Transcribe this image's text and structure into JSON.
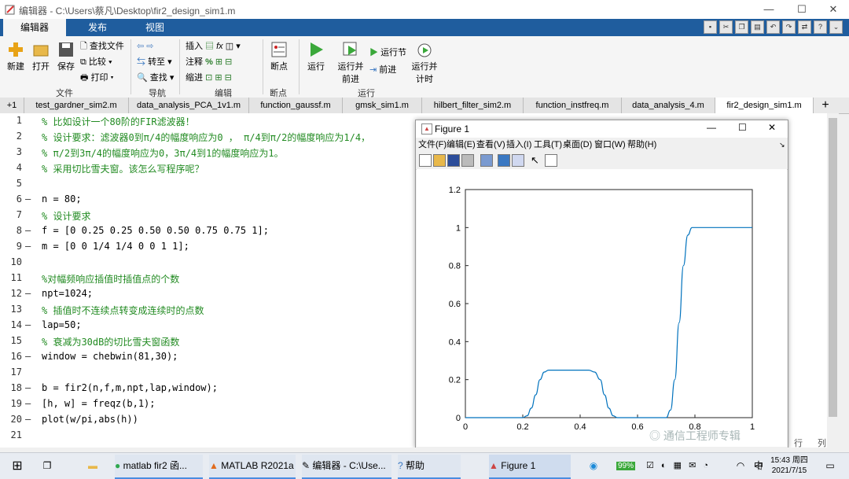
{
  "window": {
    "title": "编辑器 - C:\\Users\\蔡凡\\Desktop\\fir2_design_sim1.m"
  },
  "ribbon_tabs": [
    "编辑器",
    "发布",
    "视图"
  ],
  "ribbon": {
    "file": {
      "new": "新建",
      "open": "打开",
      "save": "保存",
      "find_files": "查找文件",
      "compare": "比较",
      "print": "打印",
      "group": "文件"
    },
    "nav": {
      "goto": "转至",
      "find": "查找",
      "group": "导航"
    },
    "edit": {
      "insert": "插入",
      "comment": "注释",
      "indent": "缩进",
      "fx": "fx",
      "group": "编辑"
    },
    "breakpoints": {
      "label": "断点",
      "group": "断点"
    },
    "run": {
      "run": "运行",
      "run_advance_1": "运行并",
      "run_advance_2": "前进",
      "run_section": "运行节",
      "advance": "前进",
      "run_time_1": "运行并",
      "run_time_2": "计时",
      "group": "运行"
    }
  },
  "file_tabs": {
    "plus": "+1",
    "items": [
      "test_gardner_sim2.m",
      "data_analysis_PCA_1v1.m",
      "function_gaussf.m",
      "gmsk_sim1.m",
      "hilbert_filter_sim2.m",
      "function_instfreq.m",
      "data_analysis_4.m",
      "fir2_design_sim1.m"
    ],
    "active": "fir2_design_sim1.m"
  },
  "code_lines": [
    {
      "n": "1",
      "dash": "",
      "text": "% 比如设计一个80阶的FIR滤波器！",
      "type": "comment"
    },
    {
      "n": "2",
      "dash": "",
      "text": "% 设计要求：滤波器0到π/4的幅度响应为0 ， π/4到π/2的幅度响应为1/4，",
      "type": "comment"
    },
    {
      "n": "3",
      "dash": "",
      "text": "% π/2到3π/4的幅度响应为0，3π/4到1的幅度响应为1。",
      "type": "comment"
    },
    {
      "n": "4",
      "dash": "",
      "text": "% 采用切比雪夫窗。该怎么写程序呢？",
      "type": "comment"
    },
    {
      "n": "5",
      "dash": "",
      "text": "",
      "type": "code"
    },
    {
      "n": "6",
      "dash": "—",
      "text": "n = 80;",
      "type": "code"
    },
    {
      "n": "7",
      "dash": "",
      "text": "% 设计要求",
      "type": "comment"
    },
    {
      "n": "8",
      "dash": "—",
      "text": "f = [0 0.25 0.25 0.50 0.50 0.75 0.75 1];",
      "type": "code"
    },
    {
      "n": "9",
      "dash": "—",
      "text": "m = [0 0 1/4 1/4 0 0 1 1];",
      "type": "code"
    },
    {
      "n": "10",
      "dash": "",
      "text": "",
      "type": "code"
    },
    {
      "n": "11",
      "dash": "",
      "text": "%对幅频响应插值时插值点的个数",
      "type": "comment"
    },
    {
      "n": "12",
      "dash": "—",
      "text": "npt=1024;",
      "type": "code"
    },
    {
      "n": "13",
      "dash": "",
      "text": "% 插值时不连续点转变成连续时的点数",
      "type": "comment"
    },
    {
      "n": "14",
      "dash": "—",
      "text": "lap=50;",
      "type": "code"
    },
    {
      "n": "15",
      "dash": "",
      "text": "% 衰减为30dB的切比雪夫窗函数",
      "type": "comment"
    },
    {
      "n": "16",
      "dash": "—",
      "text": "window = chebwin(81,30);",
      "type": "code"
    },
    {
      "n": "17",
      "dash": "",
      "text": "",
      "type": "code"
    },
    {
      "n": "18",
      "dash": "—",
      "text": "b = fir2(n,f,m,npt,lap,window);",
      "type": "code"
    },
    {
      "n": "19",
      "dash": "—",
      "text": "[h, w] = freqz(b,1);",
      "type": "code"
    },
    {
      "n": "20",
      "dash": "—",
      "text": "plot(w/pi,abs(h))",
      "type": "code"
    },
    {
      "n": "21",
      "dash": "",
      "text": "",
      "type": "code"
    }
  ],
  "figure": {
    "title": "Figure 1",
    "menu": [
      "文件(F)",
      "编辑(E)",
      "查看(V)",
      "插入(I)",
      "工具(T)",
      "桌面(D)",
      "窗口(W)",
      "帮助(H)"
    ]
  },
  "chart_data": {
    "type": "line",
    "title": "",
    "xlabel": "",
    "ylabel": "",
    "xlim": [
      0,
      1
    ],
    "ylim": [
      0,
      1.2
    ],
    "xticks": [
      "0",
      "0.2",
      "0.4",
      "0.6",
      "0.8",
      "1"
    ],
    "yticks": [
      "0",
      "0.2",
      "0.4",
      "0.6",
      "0.8",
      "1",
      "1.2"
    ],
    "color": "#0072bd",
    "series": [
      {
        "x": [
          0,
          0.2,
          0.215,
          0.23,
          0.245,
          0.26,
          0.275,
          0.29,
          0.35,
          0.43,
          0.45,
          0.47,
          0.485,
          0.5,
          0.515,
          0.53,
          0.55,
          0.7,
          0.715,
          0.73,
          0.745,
          0.76,
          0.775,
          0.79,
          0.81,
          0.9,
          1.0
        ],
        "y": [
          0,
          0,
          0.01,
          0.05,
          0.12,
          0.2,
          0.24,
          0.25,
          0.25,
          0.25,
          0.24,
          0.2,
          0.12,
          0.05,
          0.01,
          0,
          0,
          0,
          0.04,
          0.2,
          0.5,
          0.8,
          0.96,
          1.0,
          1.0,
          1.0,
          1.0
        ]
      }
    ]
  },
  "status": {
    "row": "行",
    "col": "列"
  },
  "taskbar": {
    "items": [
      "matlab fir2 函...",
      "MATLAB R2021a",
      "编辑器 - C:\\Use...",
      "帮助",
      "Figure 1"
    ],
    "battery": "99%",
    "ime": "中",
    "time": "15:43 周四",
    "date": "2021/7/15"
  },
  "watermark": "通信工程师专辑"
}
